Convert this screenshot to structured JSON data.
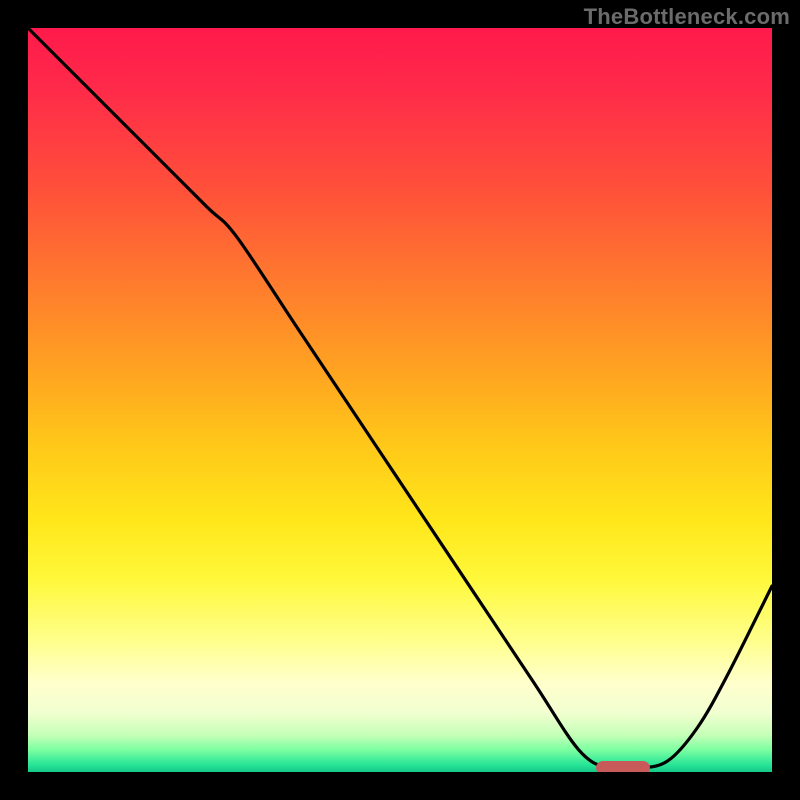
{
  "watermark": "TheBottleneck.com",
  "colors": {
    "frame": "#000000",
    "marker": "#c85a5a",
    "curve": "#000000"
  },
  "chart_data": {
    "type": "line",
    "title": "",
    "xlabel": "",
    "ylabel": "",
    "xlim": [
      0,
      100
    ],
    "ylim": [
      0,
      100
    ],
    "grid": false,
    "legend": false,
    "series": [
      {
        "name": "bottleneck-curve",
        "x": [
          0,
          8,
          16,
          24,
          28,
          36,
          44,
          52,
          60,
          68,
          74,
          78,
          82,
          86,
          90,
          94,
          100
        ],
        "y": [
          100,
          92,
          84,
          76,
          72,
          60,
          48,
          36,
          24,
          12,
          3,
          0.5,
          0.5,
          1.5,
          6,
          13,
          25
        ]
      }
    ],
    "marker": {
      "x": 80,
      "y": 0.5
    },
    "background_gradient_stops": [
      {
        "pos": 0,
        "color": "#ff1a4b"
      },
      {
        "pos": 50,
        "color": "#ffc819"
      },
      {
        "pos": 88,
        "color": "#ffffcc"
      },
      {
        "pos": 100,
        "color": "#16c98a"
      }
    ]
  }
}
